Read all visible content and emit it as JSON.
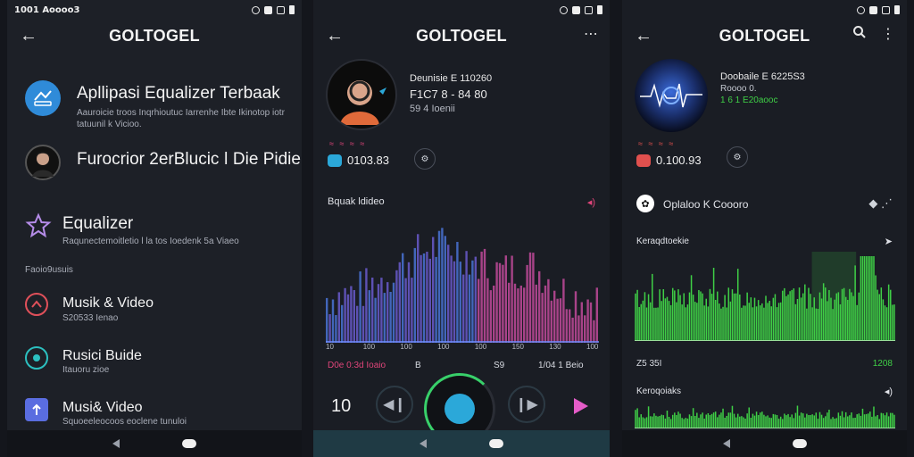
{
  "app_title": "GOLTOGEL",
  "screen1": {
    "status_time": "1001 Aoooo3",
    "items": [
      {
        "title": "Apllipasi Equalizer Terbaak",
        "subtitle": "Aauroicie troos Inqrhioutuc Iarrenhe Ibte Ikinotop iotr",
        "subtitle2": "tatuunil k Vicioo.",
        "color": "#2f8bd9"
      },
      {
        "title": "Furocrior 2erBlucic ǀ Die Pidie",
        "subtitle": "",
        "color": "#222"
      },
      {
        "title": "Equalizer",
        "subtitle": "Raqunectemoitletio l la tos Ioedenk 5a Viaeo",
        "color": "#b58ce8"
      }
    ],
    "section_label": "Faoio9usuis",
    "list": [
      {
        "title": "Musik & Video",
        "subtitle": "S20533 Ienao",
        "color": "#e0505a"
      },
      {
        "title": "Rusici Buide",
        "subtitle": "Itauoru zioe",
        "color": "#2cc0c0"
      },
      {
        "title": "Musi& Video",
        "subtitle": "Squoeeleocoos eoclene tunuloi",
        "color": "#5a6de0"
      }
    ]
  },
  "screen2": {
    "track_line1": "Deunisie E 110260",
    "track_line2": "F1C7 8 - 84 80",
    "track_line3": "59 4 Ioenii",
    "tags": "≈ ≈ ≈ ≈",
    "time_value": "0103.83",
    "eq_label": "Bquak ldideo",
    "x_ticks": [
      "10",
      "100",
      "100",
      "100",
      "100",
      "150",
      "130",
      "100"
    ],
    "bottom_left": "D0e 0:3d Ioaio",
    "bottom_mid": "B",
    "bottom_mid2": "S9",
    "bottom_right": "1/04 1 Beio",
    "control_left": "10",
    "accent": "#e0457a",
    "bars_color_start": "#4a73d6",
    "bars_color_end": "#c24a9b",
    "knob_color": "#2ba8d9",
    "ring_color": "#38d06a",
    "play_color": "#e55cc8"
  },
  "screen3": {
    "track_line1": "Doobaile E 6225S3",
    "track_line2": "Roooo 0.",
    "track_line3": "1 6 1 E20aooc",
    "tags": "≈ ≈ ≈ ≈",
    "time_value": "0.100.93",
    "optionline": "Oplaloo K Coooro",
    "eq1_label": "Keraqdtoekie",
    "eq2_label": "Keroqoiaks",
    "row_left": "Z5 35I",
    "row_right": "1208",
    "bars_color": "#3fcf46",
    "accent": "#e0504e"
  },
  "icons": {
    "back": "arrow-left-icon",
    "more": "more-vert-icon",
    "search": "search-icon"
  }
}
